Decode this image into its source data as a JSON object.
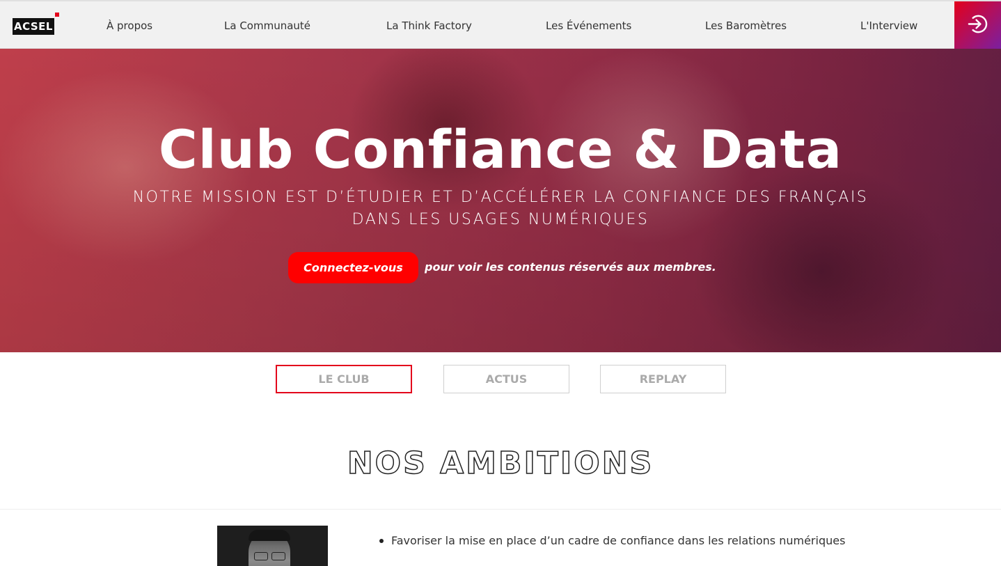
{
  "header": {
    "logo_text": "ACSEL",
    "nav": [
      "À propos",
      "La Communauté",
      "La Think Factory",
      "Les Événements",
      "Les Baromètres",
      "L'Interview"
    ],
    "login_icon": "login-arrow-icon"
  },
  "hero": {
    "title": "Club Confiance & Data",
    "subtitle_line1": "NOTRE MISSION EST D’ÉTUDIER ET D’ACCÉLÉRER LA CONFIANCE DES FRANÇAIS",
    "subtitle_line2": "DANS LES USAGES NUMÉRIQUES",
    "cta_label": "Connectez-vous",
    "cta_suffix": "pour voir les contenus réservés aux membres."
  },
  "tabs": [
    {
      "label": "LE CLUB",
      "active": true
    },
    {
      "label": "ACTUS",
      "active": false
    },
    {
      "label": "REPLAY",
      "active": false
    }
  ],
  "section": {
    "title": "NOS AMBITIONS",
    "bullets": [
      "Favoriser la mise en place d’un cadre de confiance dans les relations numériques"
    ]
  },
  "colors": {
    "accent": "#e3001b",
    "cta": "#ff0000",
    "nav_bg": "#f1f1f1"
  }
}
